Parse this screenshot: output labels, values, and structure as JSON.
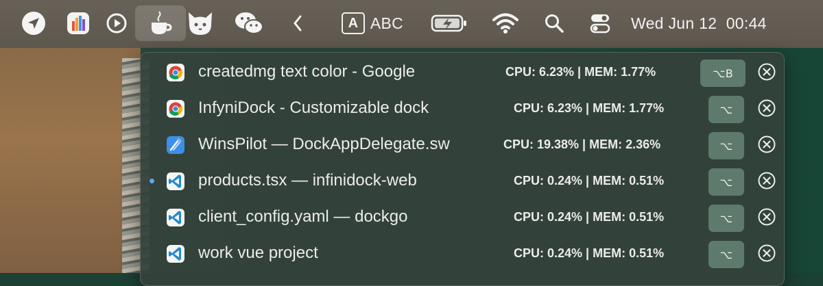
{
  "menubar": {
    "icons": [
      {
        "name": "location-arrow-icon"
      },
      {
        "name": "istat-menus-icon"
      },
      {
        "name": "play-circle-icon"
      },
      {
        "name": "coffee-cup-icon",
        "active": true
      },
      {
        "name": "cat-icon"
      },
      {
        "name": "wechat-icon"
      },
      {
        "name": "chevron-left-icon"
      }
    ],
    "input_source_badge": "A",
    "input_source_label": "ABC",
    "datetime": "Wed Jun 12  00:44"
  },
  "panel": {
    "rows": [
      {
        "title": "createdmg text color - Google",
        "stats": "CPU: 6.23% | MEM: 1.77%",
        "shortcut": "⌥B",
        "icon": "chrome-icon",
        "dot": false
      },
      {
        "title": "InfyniDock - Customizable dock",
        "stats": "CPU: 6.23% | MEM: 1.77%",
        "shortcut": "⌥",
        "icon": "chrome-icon",
        "dot": false
      },
      {
        "title": "WinsPilot — DockAppDelegate.sw",
        "stats": "CPU: 19.38% | MEM: 2.36%",
        "shortcut": "⌥",
        "icon": "xcode-icon",
        "dot": false
      },
      {
        "title": "products.tsx — infinidock-web",
        "stats": "CPU: 0.24% | MEM: 0.51%",
        "shortcut": "⌥",
        "icon": "vscode-icon",
        "dot": true
      },
      {
        "title": "client_config.yaml — dockgo",
        "stats": "CPU: 0.24% | MEM: 0.51%",
        "shortcut": "⌥",
        "icon": "vscode-icon",
        "dot": false
      },
      {
        "title": "work vue project",
        "stats": "CPU: 0.24% | MEM: 0.51%",
        "shortcut": "⌥",
        "icon": "vscode-icon",
        "dot": false
      }
    ]
  },
  "colors": {
    "accent_dot": "#5aa9ef",
    "key_button": "#5d7a6c",
    "panel_bg": "#34423a"
  }
}
